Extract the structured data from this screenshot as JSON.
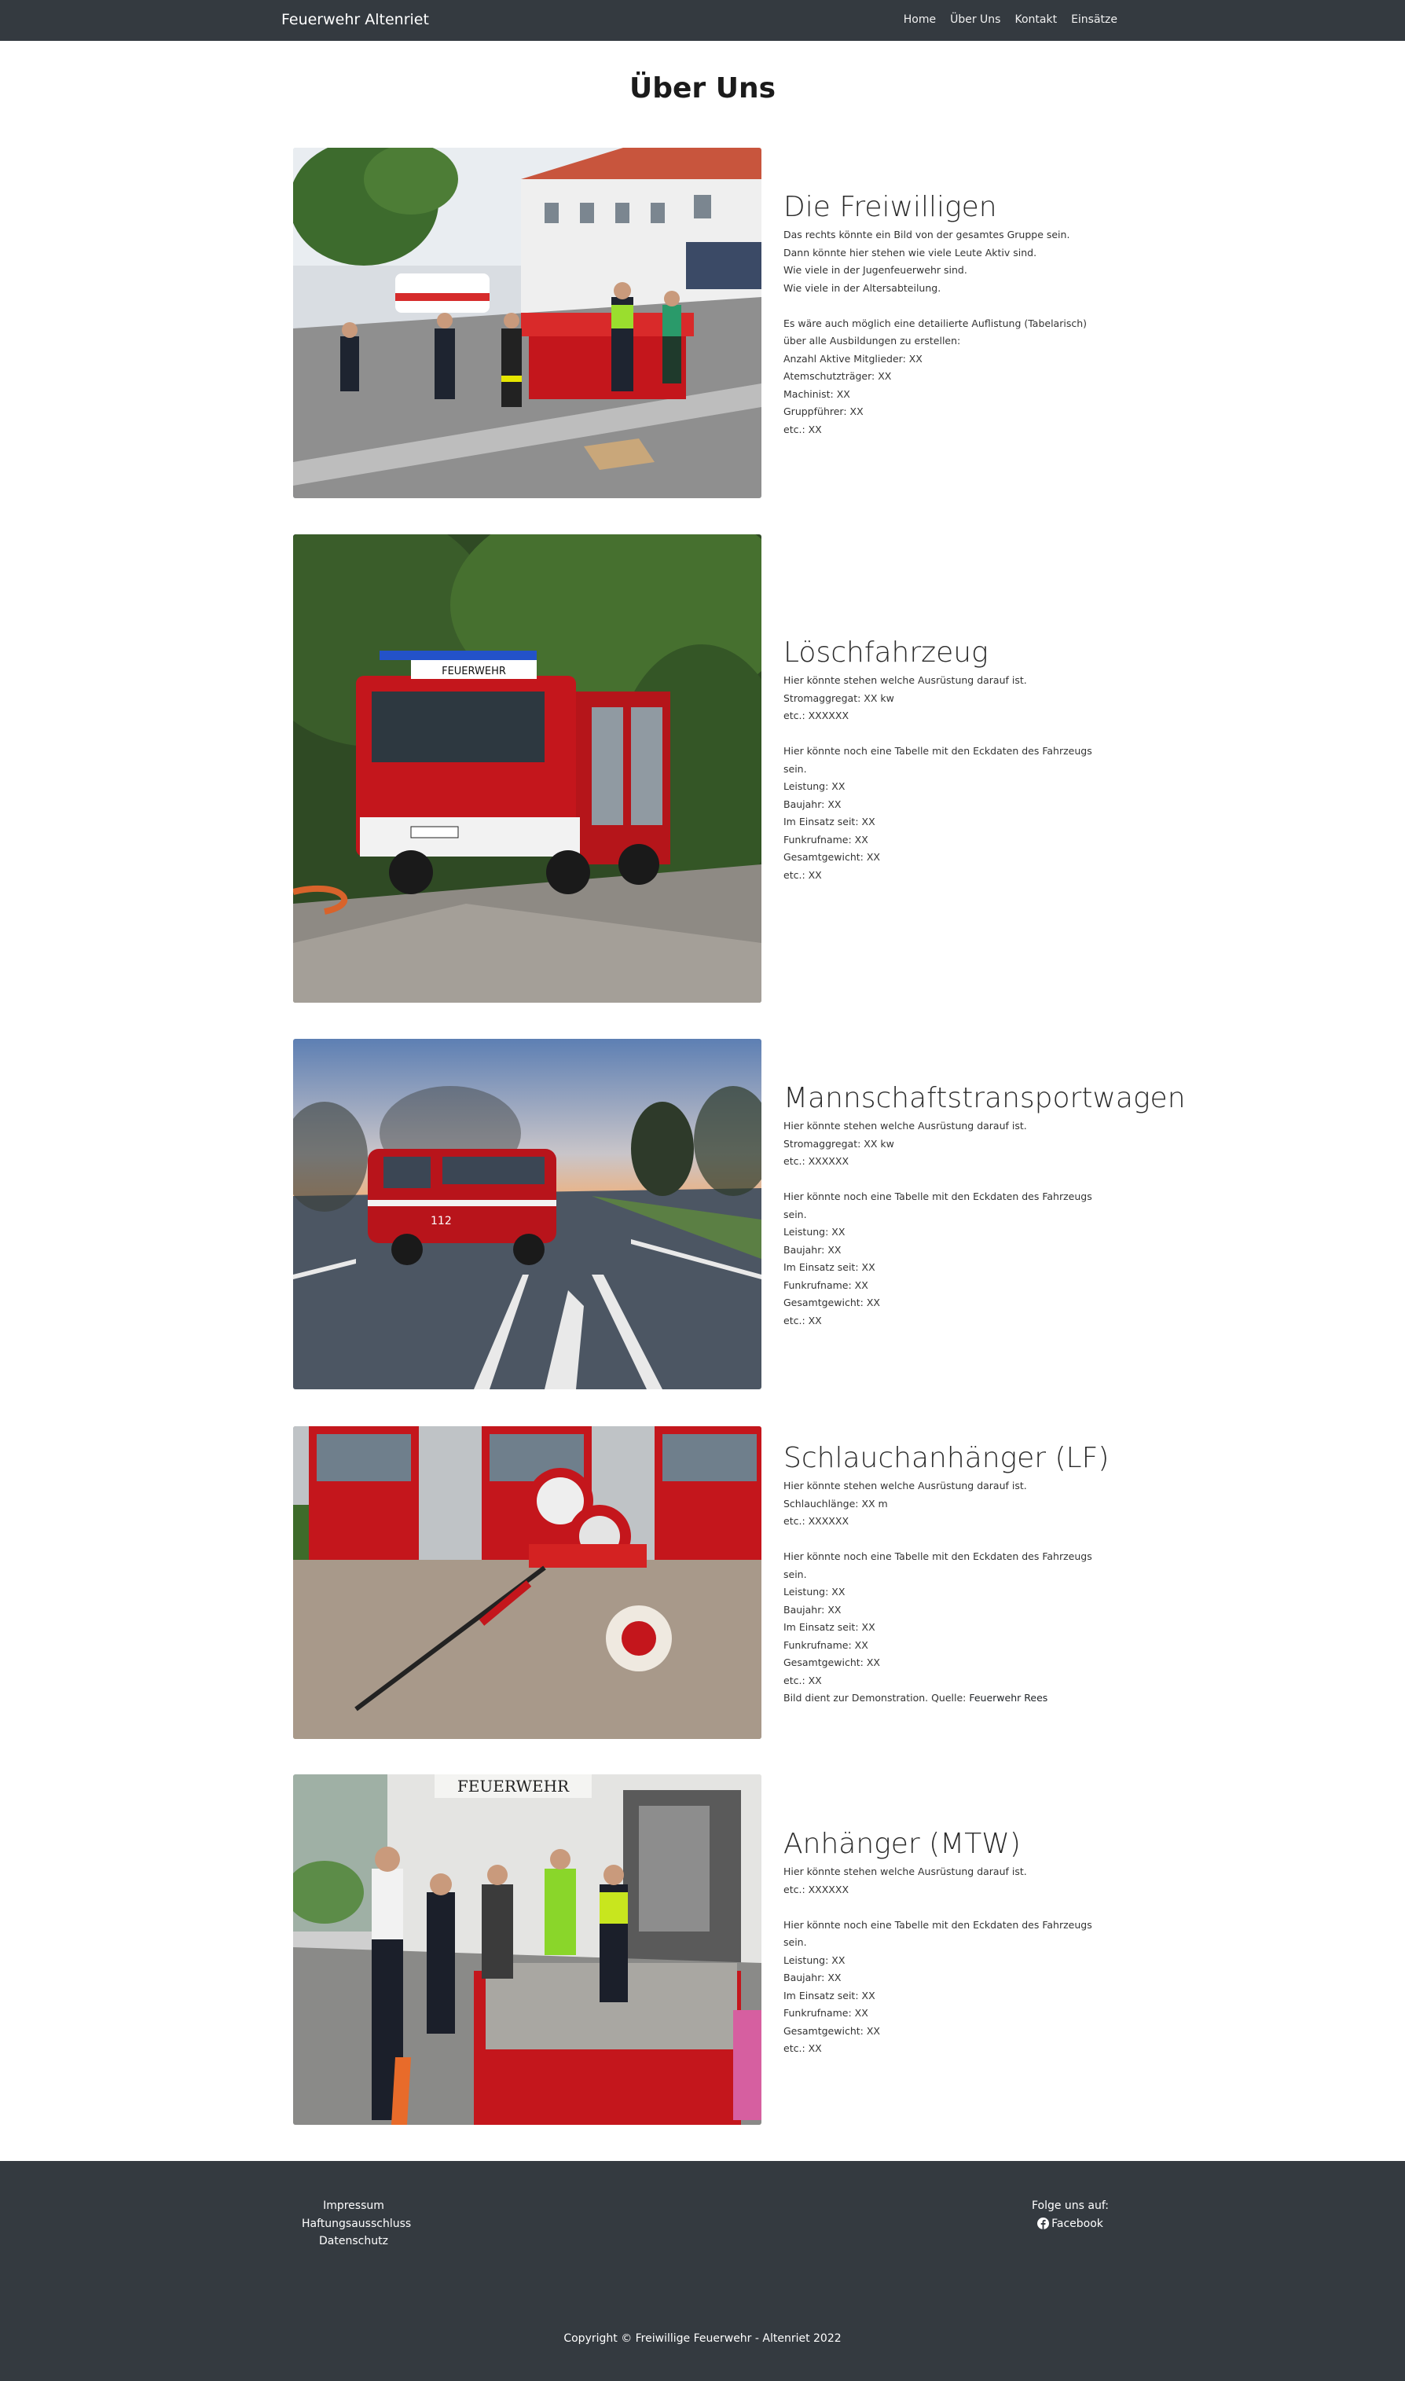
{
  "navbar": {
    "brand": "Feuerwehr Altenriet",
    "links": [
      "Home",
      "Über Uns",
      "Kontakt",
      "Einsätze"
    ]
  },
  "page_title": "Über Uns",
  "sections": [
    {
      "title": "Die Freiwilligen",
      "image": "group-photo",
      "lines": [
        "Das rechts könnte ein Bild von der gesamtes Gruppe sein.",
        "Dann könnte hier stehen wie viele Leute Aktiv sind.",
        "Wie viele in der Jugenfeuerwehr sind.",
        "Wie viele in der Altersabteilung.",
        "",
        "Es wäre auch möglich eine detailierte Auflistung (Tabelarisch)",
        "über alle Ausbildungen zu erstellen:",
        "Anzahl Aktive Mitglieder: XX",
        "Atemschutzträger: XX",
        "Machinist: XX",
        "Gruppführer: XX",
        "etc.: XX"
      ]
    },
    {
      "title": "Löschfahrzeug",
      "image": "fire-truck-photo",
      "lines": [
        "Hier könnte stehen welche Ausrüstung darauf ist.",
        "Stromaggregat: XX kw",
        "etc.: XXXXXX",
        "",
        "Hier könnte noch eine Tabelle mit den Eckdaten des Fahrzeugs",
        "sein.",
        "Leistung: XX",
        "Baujahr: XX",
        "Im Einsatz seit: XX",
        "Funkrufname: XX",
        "Gesamtgewicht: XX",
        "etc.: XX"
      ]
    },
    {
      "title": "Mannschaftstransportwagen",
      "image": "van-photo",
      "lines": [
        "Hier könnte stehen welche Ausrüstung darauf ist.",
        "Stromaggregat: XX kw",
        "etc.: XXXXXX",
        "",
        "Hier könnte noch eine Tabelle mit den Eckdaten des Fahrzeugs",
        "sein.",
        "Leistung: XX",
        "Baujahr: XX",
        "Im Einsatz seit: XX",
        "Funkrufname: XX",
        "Gesamtgewicht: XX",
        "etc.: XX"
      ]
    },
    {
      "title": "Schlauchanhänger (LF)",
      "image": "hose-trailer-photo",
      "lines": [
        "Hier könnte stehen welche Ausrüstung darauf ist.",
        "Schlauchlänge: XX m",
        "etc.: XXXXXX",
        "",
        "Hier könnte noch eine Tabelle mit den Eckdaten des Fahrzeugs",
        "sein.",
        "Leistung: XX",
        "Baujahr: XX",
        "Im Einsatz seit: XX",
        "Funkrufname: XX",
        "Gesamtgewicht: XX",
        "etc.: XX"
      ],
      "source_prefix": "Bild dient zur Demonstration. Quelle: ",
      "source_link": "Feuerwehr Rees"
    },
    {
      "title": "Anhänger (MTW)",
      "image": "trailer-sandbags-photo",
      "lines": [
        "Hier könnte stehen welche Ausrüstung darauf ist.",
        "etc.: XXXXXX",
        "",
        "Hier könnte noch eine Tabelle mit den Eckdaten des Fahrzeugs",
        "sein.",
        "Leistung: XX",
        "Baujahr: XX",
        "Im Einsatz seit: XX",
        "Funkrufname: XX",
        "Gesamtgewicht: XX",
        "etc.: XX"
      ]
    }
  ],
  "photo_labels": {
    "truck_sign": "FEUERWEHR",
    "building_sign": "FEUERWEHR",
    "van_number": "112"
  },
  "footer": {
    "links": [
      "Impressum",
      "Haftungsausschluss",
      "Datenschutz"
    ],
    "follow_label": "Folge uns auf:",
    "facebook_label": "Facebook",
    "copyright": "Copyright © Freiwillige Feuerwehr - Altenriet 2022"
  },
  "colors": {
    "navbar_bg": "#343a40",
    "footer_bg": "#343a40",
    "fire_red": "#c4161c"
  }
}
